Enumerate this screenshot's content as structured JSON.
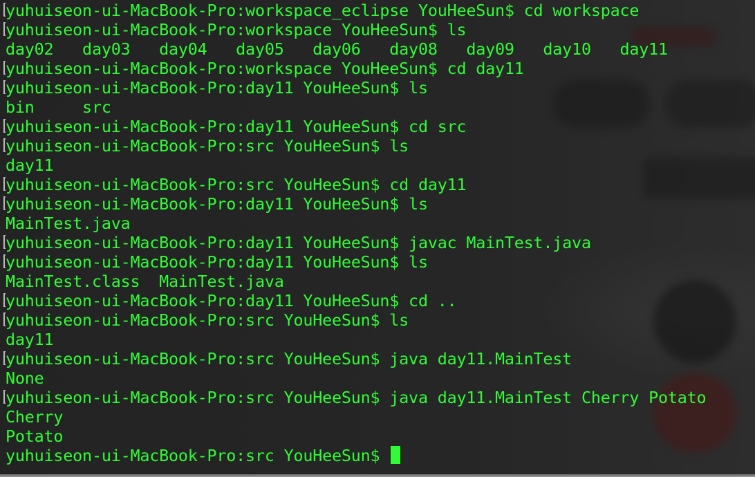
{
  "terminal": {
    "lines": [
      {
        "prefix": "[",
        "text": "yuhuiseon-ui-MacBook-Pro:workspace_eclipse YouHeeSun$ cd workspace"
      },
      {
        "prefix": "[",
        "text": "yuhuiseon-ui-MacBook-Pro:workspace YouHeeSun$ ls"
      },
      {
        "prefix": "",
        "text": "day02   day03   day04   day05   day06   day08   day09   day10   day11"
      },
      {
        "prefix": "[",
        "text": "yuhuiseon-ui-MacBook-Pro:workspace YouHeeSun$ cd day11"
      },
      {
        "prefix": "[",
        "text": "yuhuiseon-ui-MacBook-Pro:day11 YouHeeSun$ ls"
      },
      {
        "prefix": "",
        "text": "bin     src"
      },
      {
        "prefix": "[",
        "text": "yuhuiseon-ui-MacBook-Pro:day11 YouHeeSun$ cd src"
      },
      {
        "prefix": "[",
        "text": "yuhuiseon-ui-MacBook-Pro:src YouHeeSun$ ls"
      },
      {
        "prefix": "",
        "text": "day11"
      },
      {
        "prefix": "[",
        "text": "yuhuiseon-ui-MacBook-Pro:src YouHeeSun$ cd day11"
      },
      {
        "prefix": "[",
        "text": "yuhuiseon-ui-MacBook-Pro:day11 YouHeeSun$ ls"
      },
      {
        "prefix": "",
        "text": "MainTest.java"
      },
      {
        "prefix": "[",
        "text": "yuhuiseon-ui-MacBook-Pro:day11 YouHeeSun$ javac MainTest.java"
      },
      {
        "prefix": "[",
        "text": "yuhuiseon-ui-MacBook-Pro:day11 YouHeeSun$ ls"
      },
      {
        "prefix": "",
        "text": "MainTest.class  MainTest.java"
      },
      {
        "prefix": "[",
        "text": "yuhuiseon-ui-MacBook-Pro:day11 YouHeeSun$ cd .."
      },
      {
        "prefix": "[",
        "text": "yuhuiseon-ui-MacBook-Pro:src YouHeeSun$ ls"
      },
      {
        "prefix": "",
        "text": "day11"
      },
      {
        "prefix": "[",
        "text": "yuhuiseon-ui-MacBook-Pro:src YouHeeSun$ java day11.MainTest"
      },
      {
        "prefix": "",
        "text": "None"
      },
      {
        "prefix": "[",
        "text": "yuhuiseon-ui-MacBook-Pro:src YouHeeSun$ java day11.MainTest Cherry Potato"
      },
      {
        "prefix": "",
        "text": "Cherry"
      },
      {
        "prefix": "",
        "text": "Potato"
      }
    ],
    "prompt": "yuhuiseon-ui-MacBook-Pro:src YouHeeSun$ ",
    "colors": {
      "text": "#2dfe33",
      "background": "#262626",
      "bracket": "#bcbcbc"
    }
  }
}
